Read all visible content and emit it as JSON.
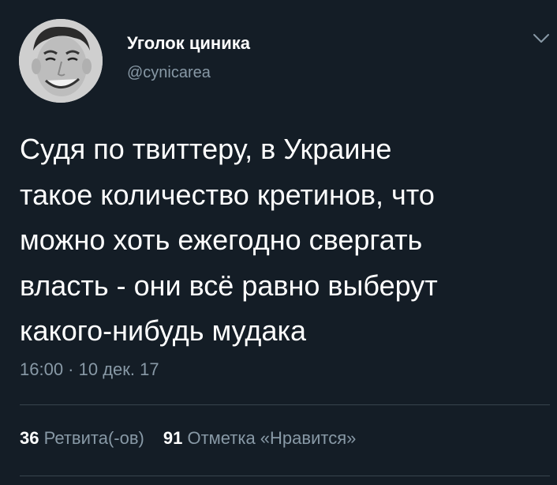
{
  "author": {
    "name": "Уголок циника",
    "handle": "@cynicarea",
    "avatar_icon": "avatar-photo"
  },
  "tweet": {
    "lines": [
      "Судя по твиттеру, в Украине",
      "такое количество кретинов, что",
      "можно хоть ежегодно свергать",
      "власть - они всё равно выберут",
      "какого-нибудь мудака"
    ],
    "timestamp": "16:00 · 10 дек. 17"
  },
  "stats": {
    "retweets_count": "36",
    "retweets_label": "Ретвита(-ов)",
    "likes_count": "91",
    "likes_label": "Отметка «Нравится»"
  },
  "icons": {
    "menu": "chevron-down-icon"
  },
  "colors": {
    "background": "#141d26",
    "text": "#ffffff",
    "secondary": "#8899a6",
    "divider": "#38444d"
  }
}
